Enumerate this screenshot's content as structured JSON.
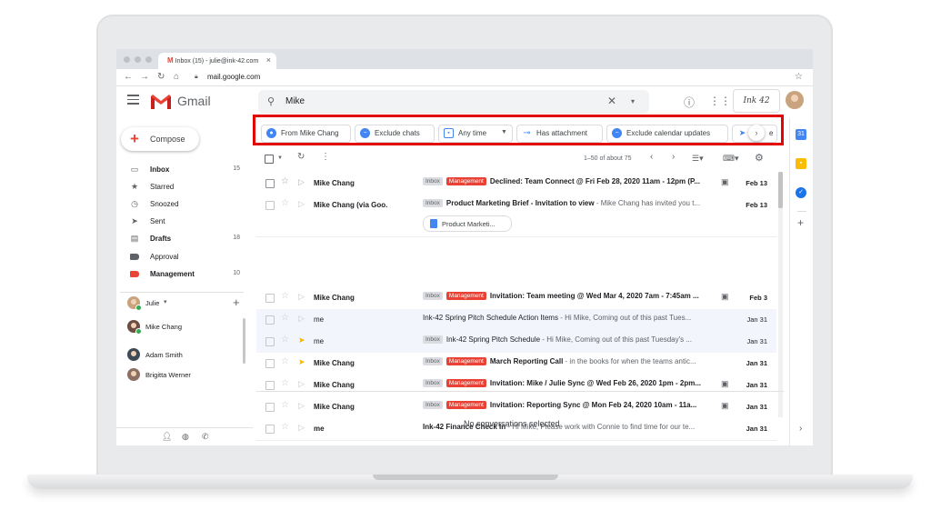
{
  "browser": {
    "tab_title": "Inbox (15) - julie@ink-42.com",
    "tab_close": "×",
    "url": "mail.google.com",
    "gmail_icon": "M"
  },
  "header": {
    "app_name": "Gmail",
    "search_value": "Mike",
    "account_logo_text": "Ink 42"
  },
  "compose": {
    "label": "Compose"
  },
  "sidebar": {
    "items": [
      {
        "label": "Inbox",
        "count": "15",
        "icon": "inbox-icon"
      },
      {
        "label": "Starred",
        "count": "",
        "icon": "star-icon"
      },
      {
        "label": "Snoozed",
        "count": "",
        "icon": "clock-icon"
      },
      {
        "label": "Sent",
        "count": "",
        "icon": "send-icon"
      },
      {
        "label": "Drafts",
        "count": "18",
        "icon": "draft-icon"
      },
      {
        "label": "Approval",
        "count": "",
        "icon": "label-icon"
      },
      {
        "label": "Management",
        "count": "10",
        "icon": "label-icon"
      }
    ],
    "label_colors": {
      "approval": "#5f6368",
      "management": "#ea4335"
    }
  },
  "contacts": {
    "me": "Julie",
    "items": [
      "Mike Chang",
      "Adam Smith",
      "Brigitta Werner"
    ]
  },
  "chips": [
    {
      "label": "From Mike Chang",
      "icon": "person-icon"
    },
    {
      "label": "Exclude chats",
      "icon": "minus-circle-icon"
    },
    {
      "label": "Any time",
      "icon": "calendar-icon"
    },
    {
      "label": "Has attachment",
      "icon": "link-icon"
    },
    {
      "label": "Exclude calendar updates",
      "icon": "minus-circle-icon"
    },
    {
      "label": "e",
      "icon": "send-icon"
    }
  ],
  "toolbar": {
    "page_info": "1–50 of about 75"
  },
  "emails": [
    {
      "sender": "Mike Chang",
      "inbox_tag": "Inbox",
      "label": "Management",
      "subject": "Declined: Team Connect @ Fri Feb 28, 2020 11am - 12pm (P...",
      "snippet": "",
      "date": "Feb 13",
      "calendar": true,
      "unread": true,
      "important": false
    },
    {
      "sender": "Mike Chang (via Goo.",
      "inbox_tag": "Inbox",
      "label": "",
      "subject": "Product Marketing Brief - Invitation to view",
      "snippet": " - Mike Chang has invited you t...",
      "date": "Feb 13",
      "calendar": false,
      "unread": true,
      "important": false,
      "attachment": "Product Marketi..."
    },
    {
      "sender": "Mike Chang",
      "inbox_tag": "Inbox",
      "label": "Management",
      "subject": "Invitation: Team meeting @ Wed Mar 4, 2020 7am - 7:45am ...",
      "snippet": "",
      "date": "Feb 3",
      "calendar": true,
      "unread": true,
      "important": false
    },
    {
      "sender": "me",
      "inbox_tag": "",
      "label": "",
      "subject": "Ink-42 Spring Pitch Schedule Action Items",
      "snippet": " - Hi Mike, Coming out of this past Tues...",
      "date": "Jan 31",
      "calendar": false,
      "unread": false,
      "important": false
    },
    {
      "sender": "me",
      "inbox_tag": "Inbox",
      "label": "",
      "subject": "Ink-42 Spring Pitch Schedule",
      "snippet": " - Hi Mike, Coming out of this past Tuesday's ...",
      "date": "Jan 31",
      "calendar": false,
      "unread": false,
      "important": true
    },
    {
      "sender": "Mike Chang",
      "inbox_tag": "Inbox",
      "label": "Management",
      "subject": "March Reporting Call",
      "snippet": " - in the books for when the teams antic...",
      "date": "Jan 31",
      "calendar": false,
      "unread": true,
      "important": true
    },
    {
      "sender": "Mike Chang",
      "inbox_tag": "Inbox",
      "label": "Management",
      "subject": "Invitation: Mike / Julie Sync @ Wed Feb 26, 2020 1pm - 2pm...",
      "snippet": "",
      "date": "Jan 31",
      "calendar": true,
      "unread": true,
      "important": false
    },
    {
      "sender": "Mike Chang",
      "inbox_tag": "Inbox",
      "label": "Management",
      "subject": "Invitation: Reporting Sync @ Mon Feb 24, 2020 10am - 11a...",
      "snippet": "",
      "date": "Jan 31",
      "calendar": true,
      "unread": true,
      "important": false
    },
    {
      "sender": "me",
      "inbox_tag": "",
      "label": "",
      "subject": "Ink-42 Finance Check In",
      "snippet": " - Hi Mike, Please work with Connie to find time for our te...",
      "date": "Jan 31",
      "calendar": false,
      "unread": true,
      "important": false
    }
  ],
  "preview": {
    "empty_text": "No conversations selected"
  },
  "colors": {
    "accent_red": "#e10600",
    "gmail_red": "#ea4335",
    "blue": "#4285f4"
  }
}
